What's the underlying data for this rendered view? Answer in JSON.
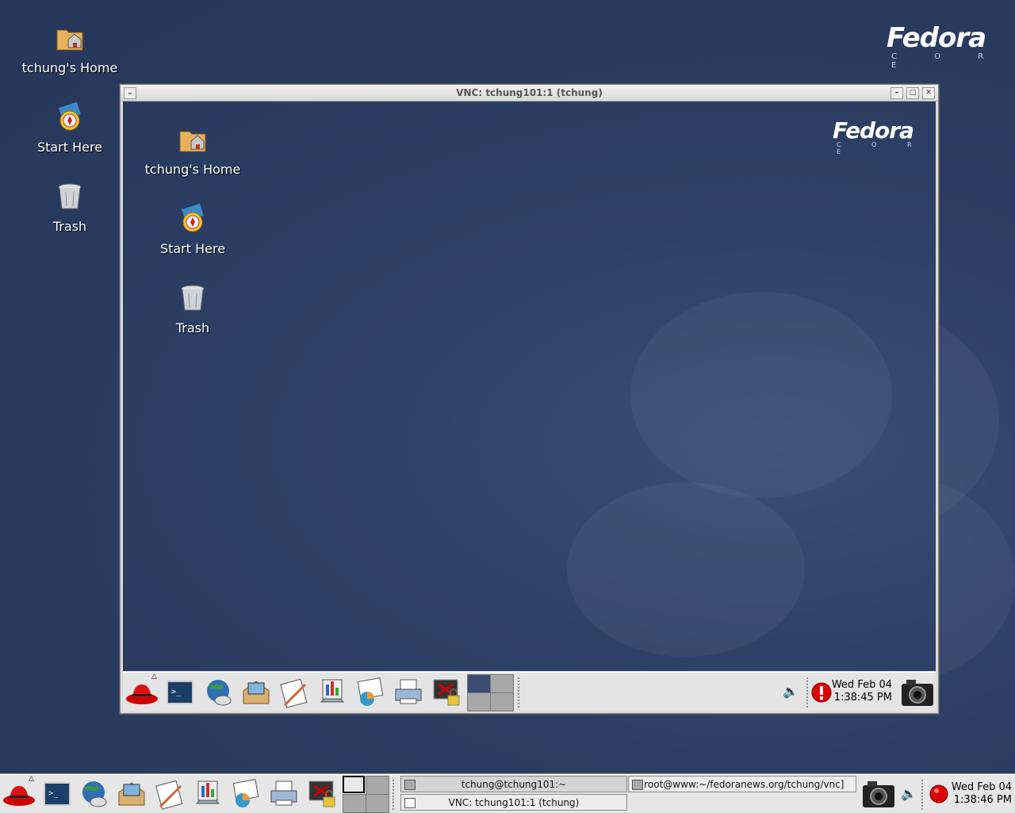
{
  "desktop": {
    "logo": {
      "brand": "Fedora",
      "sub": "C O R E"
    },
    "icons": [
      {
        "label": "tchung's Home",
        "icon": "home-folder-icon"
      },
      {
        "label": "Start Here",
        "icon": "start-here-icon"
      },
      {
        "label": "Trash",
        "icon": "trash-icon"
      }
    ]
  },
  "vnc_window": {
    "title": "VNC: tchung101:1 (tchung)",
    "desktop": {
      "logo": {
        "brand": "Fedora",
        "sub": "C O R E"
      },
      "icons": [
        {
          "label": "tchung's Home",
          "icon": "home-folder-icon"
        },
        {
          "label": "Start Here",
          "icon": "start-here-icon"
        },
        {
          "label": "Trash",
          "icon": "trash-icon"
        }
      ]
    },
    "panel": {
      "launchers": [
        "redhat-menu-icon",
        "terminal-icon",
        "web-browser-icon",
        "email-icon",
        "writer-icon",
        "impress-icon",
        "calc-icon",
        "print-manager-icon",
        "lock-screen-icon"
      ],
      "clock": {
        "date": "Wed Feb 04",
        "time": "1:38:45 PM"
      }
    }
  },
  "panel": {
    "launchers": [
      "redhat-menu-icon",
      "terminal-icon",
      "web-browser-icon",
      "email-icon",
      "writer-icon",
      "impress-icon",
      "calc-icon",
      "print-manager-icon",
      "lock-screen-icon"
    ],
    "tasks": [
      {
        "label": "tchung@tchung101:~"
      },
      {
        "label": "[root@www:~/fedoranews.org/tchung/vnc]"
      },
      {
        "label": "VNC: tchung101:1 (tchung)"
      }
    ],
    "clock": {
      "date": "Wed Feb 04",
      "time": "1:38:46 PM"
    }
  },
  "colors": {
    "desktop": "#2c3e63",
    "panel": "#e6e6e6"
  }
}
